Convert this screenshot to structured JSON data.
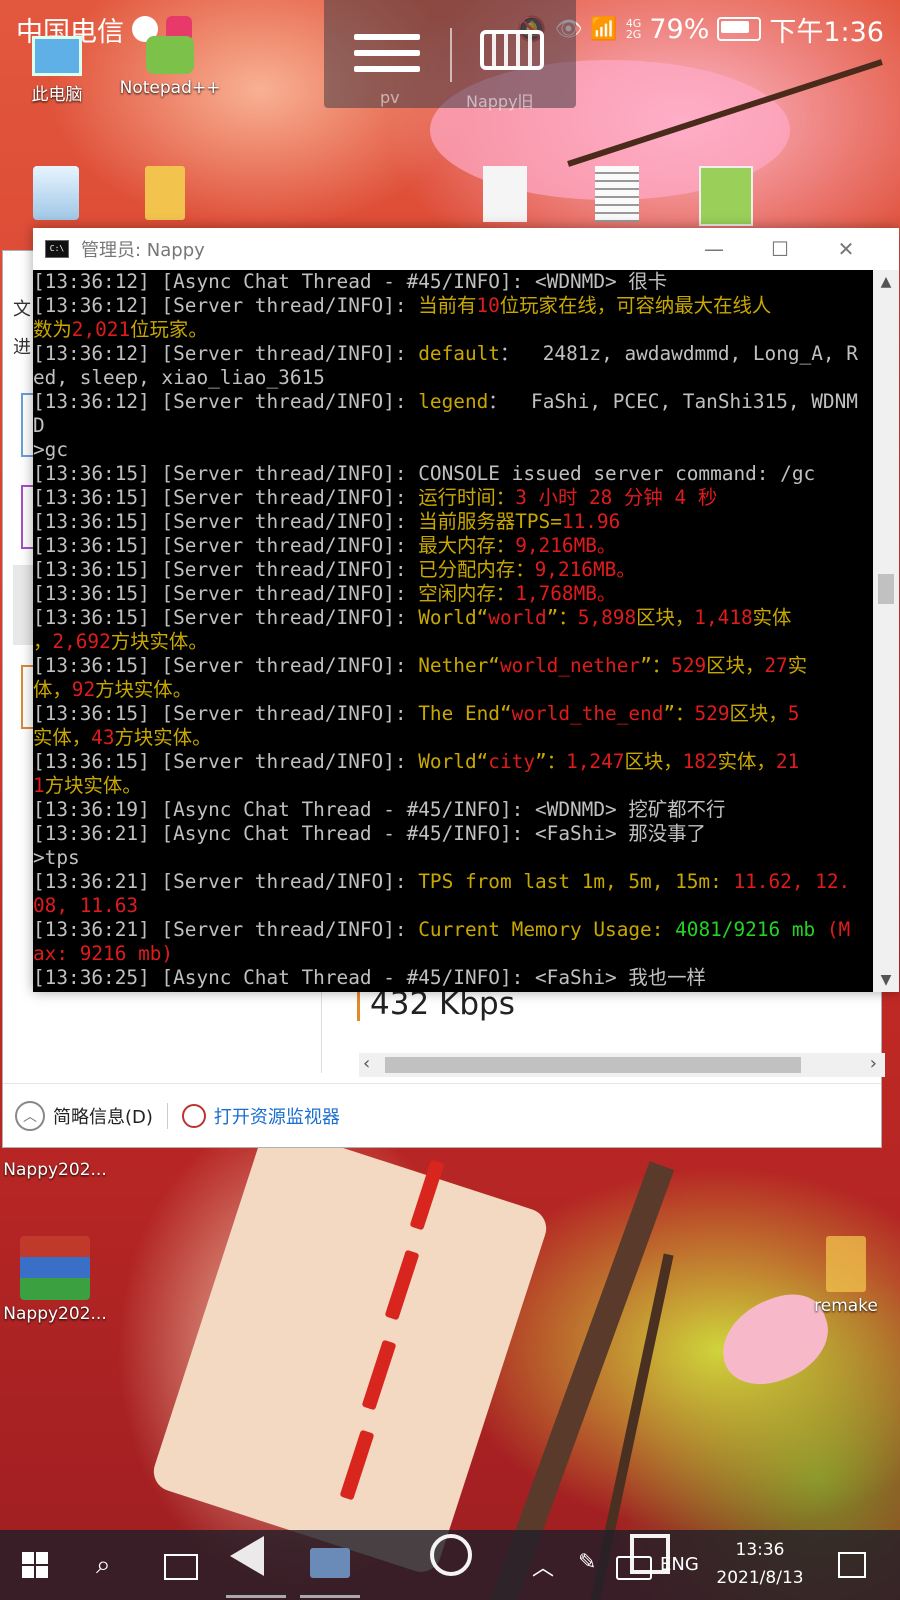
{
  "status_bar": {
    "carrier": "中国电信",
    "network": "4G\n2G",
    "battery": "79%",
    "time": "下午1:36"
  },
  "floating_toolbar": {
    "label_left": "pv",
    "label_right": "Nappy旧"
  },
  "desktop_icons": {
    "this_pc": "此电脑",
    "notepadpp": "Notepad++",
    "nappy_folder": "Nappy202...",
    "nappy_archive": "Nappy202...",
    "remake": "remake"
  },
  "task_manager": {
    "speed": "432 Kbps",
    "sidebar_fragments": [
      "文",
      "进"
    ],
    "fewer_details": "简略信息(D)",
    "open_resource_monitor": "打开资源监视器"
  },
  "console": {
    "title": "管理员: Nappy",
    "icon_text": "C:\\",
    "lines": [
      [
        [
          "w",
          "[13:36:12] [Async Chat Thread - #45/INFO]: <WDNMD> 很卡"
        ]
      ],
      [
        [
          "w",
          "[13:36:12] [Server thread/INFO]: "
        ],
        [
          "y",
          "当前有"
        ],
        [
          "r",
          "10"
        ],
        [
          "y",
          "位玩家在线，可容纳最大在线人"
        ]
      ],
      [
        [
          "y",
          "数为"
        ],
        [
          "r",
          "2,021"
        ],
        [
          "y",
          "位玩家。"
        ]
      ],
      [
        [
          "w",
          "[13:36:12] [Server thread/INFO]: "
        ],
        [
          "y",
          "default"
        ],
        [
          "w",
          "：  2481z, awdawdmmd, Long_A, R"
        ]
      ],
      [
        [
          "w",
          "ed, sleep, xiao_liao_3615"
        ]
      ],
      [
        [
          "w",
          "[13:36:12] [Server thread/INFO]: "
        ],
        [
          "y",
          "legend"
        ],
        [
          "w",
          "：  FaShi, PCEC, TanShi315, WDNM"
        ]
      ],
      [
        [
          "w",
          "D"
        ]
      ],
      [
        [
          "w",
          ">gc"
        ]
      ],
      [
        [
          "w",
          "[13:36:15] [Server thread/INFO]: CONSOLE issued server command: /gc"
        ]
      ],
      [
        [
          "w",
          "[13:36:15] [Server thread/INFO]: "
        ],
        [
          "y",
          "运行时间："
        ],
        [
          "r",
          "3 小时 28 分钟 4 秒"
        ]
      ],
      [
        [
          "w",
          "[13:36:15] [Server thread/INFO]: "
        ],
        [
          "y",
          "当前服务器TPS="
        ],
        [
          "r",
          "11.96"
        ]
      ],
      [
        [
          "w",
          "[13:36:15] [Server thread/INFO]: "
        ],
        [
          "y",
          "最大内存："
        ],
        [
          "r",
          "9,216MB。"
        ]
      ],
      [
        [
          "w",
          "[13:36:15] [Server thread/INFO]: "
        ],
        [
          "y",
          "已分配内存："
        ],
        [
          "r",
          "9,216MB。"
        ]
      ],
      [
        [
          "w",
          "[13:36:15] [Server thread/INFO]: "
        ],
        [
          "y",
          "空闲内存："
        ],
        [
          "r",
          "1,768MB。"
        ]
      ],
      [
        [
          "w",
          "[13:36:15] [Server thread/INFO]: "
        ],
        [
          "y",
          "World“"
        ],
        [
          "r",
          "world"
        ],
        [
          "y",
          "”："
        ],
        [
          "r",
          "5,898"
        ],
        [
          "y",
          "区块，"
        ],
        [
          "r",
          "1,418"
        ],
        [
          "y",
          "实体"
        ]
      ],
      [
        [
          "y",
          "，"
        ],
        [
          "r",
          "2,692"
        ],
        [
          "y",
          "方块实体。"
        ]
      ],
      [
        [
          "w",
          "[13:36:15] [Server thread/INFO]: "
        ],
        [
          "y",
          "Nether“"
        ],
        [
          "r",
          "world_nether"
        ],
        [
          "y",
          "”："
        ],
        [
          "r",
          "529"
        ],
        [
          "y",
          "区块，"
        ],
        [
          "r",
          "27"
        ],
        [
          "y",
          "实"
        ]
      ],
      [
        [
          "y",
          "体，"
        ],
        [
          "r",
          "92"
        ],
        [
          "y",
          "方块实体。"
        ]
      ],
      [
        [
          "w",
          "[13:36:15] [Server thread/INFO]: "
        ],
        [
          "y",
          "The End“"
        ],
        [
          "r",
          "world_the_end"
        ],
        [
          "y",
          "”："
        ],
        [
          "r",
          "529"
        ],
        [
          "y",
          "区块，"
        ],
        [
          "r",
          "5"
        ]
      ],
      [
        [
          "y",
          "实体，"
        ],
        [
          "r",
          "43"
        ],
        [
          "y",
          "方块实体。"
        ]
      ],
      [
        [
          "w",
          "[13:36:15] [Server thread/INFO]: "
        ],
        [
          "y",
          "World“"
        ],
        [
          "r",
          "city"
        ],
        [
          "y",
          "”："
        ],
        [
          "r",
          "1,247"
        ],
        [
          "y",
          "区块，"
        ],
        [
          "r",
          "182"
        ],
        [
          "y",
          "实体，"
        ],
        [
          "r",
          "21"
        ]
      ],
      [
        [
          "r",
          "1"
        ],
        [
          "y",
          "方块实体。"
        ]
      ],
      [
        [
          "w",
          "[13:36:19] [Async Chat Thread - #45/INFO]: <WDNMD> 挖矿都不行"
        ]
      ],
      [
        [
          "w",
          "[13:36:21] [Async Chat Thread - #45/INFO]: <FaShi> 那没事了"
        ]
      ],
      [
        [
          "w",
          ">tps"
        ]
      ],
      [
        [
          "w",
          "[13:36:21] [Server thread/INFO]: "
        ],
        [
          "y",
          "TPS from last 1m, 5m, 15m: "
        ],
        [
          "r",
          "11.62, 12."
        ]
      ],
      [
        [
          "r",
          "08, 11.63"
        ]
      ],
      [
        [
          "w",
          "[13:36:21] [Server thread/INFO]: "
        ],
        [
          "y",
          "Current Memory Usage: "
        ],
        [
          "g",
          "4081/9216 mb"
        ],
        [
          "r",
          " (M"
        ]
      ],
      [
        [
          "r",
          "ax: 9216 mb)"
        ]
      ],
      [
        [
          "w",
          "[13:36:25] [Async Chat Thread - #45/INFO]: <FaShi> 我也一样"
        ]
      ]
    ]
  },
  "taskbar": {
    "lang": "ENG",
    "clock_time": "13:36",
    "clock_date": "2021/8/13"
  },
  "colors": {
    "console_bg": "#000000",
    "log_default": "#c0c0c0",
    "log_yellow": "#c8a800",
    "log_red": "#e01b1b",
    "log_green": "#23d223",
    "link_blue": "#1a6fd0"
  }
}
